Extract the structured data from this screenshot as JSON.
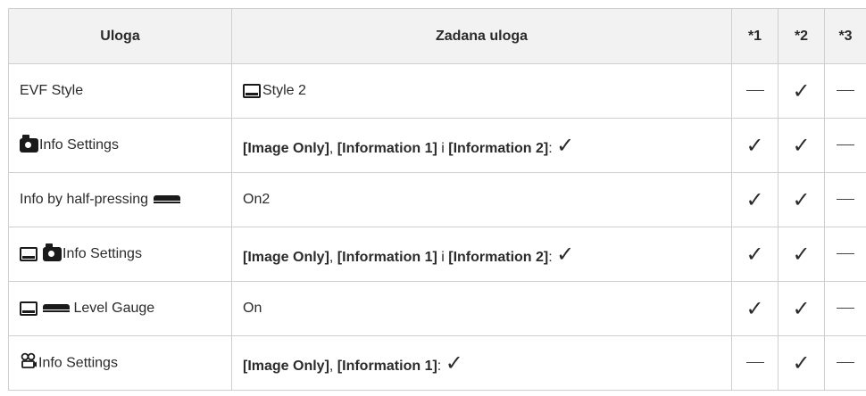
{
  "header": {
    "col_role": "Uloga",
    "col_default": "Zadana uloga",
    "col_1": "*1",
    "col_2": "*2",
    "col_3": "*3"
  },
  "rows": [
    {
      "label": "EVF Style",
      "default_text": "Style 2",
      "icon": "evf-icon",
      "c1": "dash",
      "c2": "check",
      "c3": "dash"
    },
    {
      "label": "Info Settings",
      "icon": "camera-icon",
      "default": {
        "a": "[Image Only]",
        "sep1": ", ",
        "b": "[Information 1]",
        "sep2": " i ",
        "c": "[Information 2]",
        "end": ": "
      },
      "c1": "check",
      "c2": "check",
      "c3": "dash"
    },
    {
      "label": "Info by half-pressing",
      "icon": "half-press-icon",
      "default_text": "On2",
      "c1": "check",
      "c2": "check",
      "c3": "dash"
    },
    {
      "label": "Info Settings",
      "icons": [
        "evf-icon",
        "camera-icon"
      ],
      "default": {
        "a": "[Image Only]",
        "sep1": ", ",
        "b": "[Information 1]",
        "sep2": " i ",
        "c": "[Information 2]",
        "end": ": "
      },
      "c1": "check",
      "c2": "check",
      "c3": "dash"
    },
    {
      "label": " Level Gauge",
      "icons": [
        "evf-icon",
        "half-press-icon"
      ],
      "default_text": "On",
      "c1": "check",
      "c2": "check",
      "c3": "dash"
    },
    {
      "label": "Info Settings",
      "icon": "movie-icon",
      "default": {
        "a": "[Image Only]",
        "sep1": ", ",
        "b": "[Information 1]",
        "end": ": "
      },
      "c1": "dash",
      "c2": "check",
      "c3": "dash"
    }
  ],
  "symbols": {
    "check": "✓",
    "dash": "—",
    "movie": "🎥"
  }
}
